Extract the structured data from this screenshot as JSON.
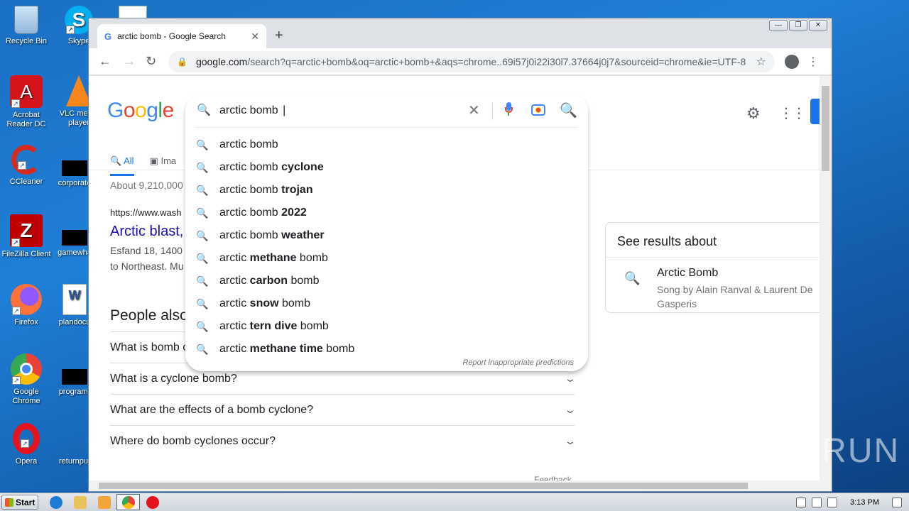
{
  "desktop": {
    "icons": [
      {
        "label": "Recycle Bin"
      },
      {
        "label": "Skype"
      },
      {
        "label": "Acrobat Reader DC"
      },
      {
        "label": "VLC media player"
      },
      {
        "label": "CCleaner"
      },
      {
        "label": "corporate"
      },
      {
        "label": "FileZilla Client"
      },
      {
        "label": "gamewha"
      },
      {
        "label": "Firefox"
      },
      {
        "label": "plandocu"
      },
      {
        "label": "Google Chrome"
      },
      {
        "label": "programr"
      },
      {
        "label": "Opera"
      },
      {
        "label": "returnput"
      }
    ]
  },
  "browser": {
    "tab_title": "arctic bomb - Google Search",
    "tab_favicon": "G",
    "tab_close": "✕",
    "new_tab": "+",
    "url_host": "google.com",
    "url_rest": "/search?q=arctic+bomb&oq=arctic+bomb+&aqs=chrome..69i57j0i22i30l7.37664j0j7&sourceid=chrome&ie=UTF-8",
    "window_controls": {
      "minimize": "—",
      "restore": "❐",
      "close": "✕"
    }
  },
  "google": {
    "logo": {
      "G": "G",
      "o1": "o",
      "o2": "o",
      "g": "g",
      "l": "l",
      "e": "e"
    },
    "search_query": "arctic bomb ",
    "tabs": {
      "all": "All",
      "images": "Ima"
    },
    "results_count": "About 9,210,000",
    "result": {
      "url": "https://www.wash",
      "title": "Arctic blast,",
      "snippet_line1": "Esfand 18, 1400",
      "snippet_line2": "to Northeast. Mu"
    },
    "paa": {
      "title": "People also",
      "questions": [
        "What is bomb c",
        "What is a cyclone bomb?",
        "What are the effects of a bomb cyclone?",
        "Where do bomb cyclones occur?"
      ],
      "feedback": "Feedback"
    },
    "knowledge_panel": {
      "title": "See results about",
      "name": "Arctic Bomb",
      "description": "Song by Alain Ranval & Laurent De Gasperis"
    },
    "suggestions": [
      {
        "plain": "arctic bomb",
        "bold": "",
        "tail": ""
      },
      {
        "plain": "arctic bomb ",
        "bold": "cyclone",
        "tail": ""
      },
      {
        "plain": "arctic bomb ",
        "bold": "trojan",
        "tail": ""
      },
      {
        "plain": "arctic bomb ",
        "bold": "2022",
        "tail": ""
      },
      {
        "plain": "arctic bomb ",
        "bold": "weather",
        "tail": ""
      },
      {
        "plain": "arctic ",
        "bold": "methane",
        "tail": " bomb"
      },
      {
        "plain": "arctic ",
        "bold": "carbon",
        "tail": " bomb"
      },
      {
        "plain": "arctic ",
        "bold": "snow",
        "tail": " bomb"
      },
      {
        "plain": "arctic ",
        "bold": "tern dive",
        "tail": " bomb"
      },
      {
        "plain": "arctic ",
        "bold": "methane time",
        "tail": " bomb"
      }
    ],
    "report_link": "Report inappropriate predictions"
  },
  "watermark": "ANY RUN",
  "taskbar": {
    "start_label": "Start",
    "clock": "3:13 PM"
  }
}
